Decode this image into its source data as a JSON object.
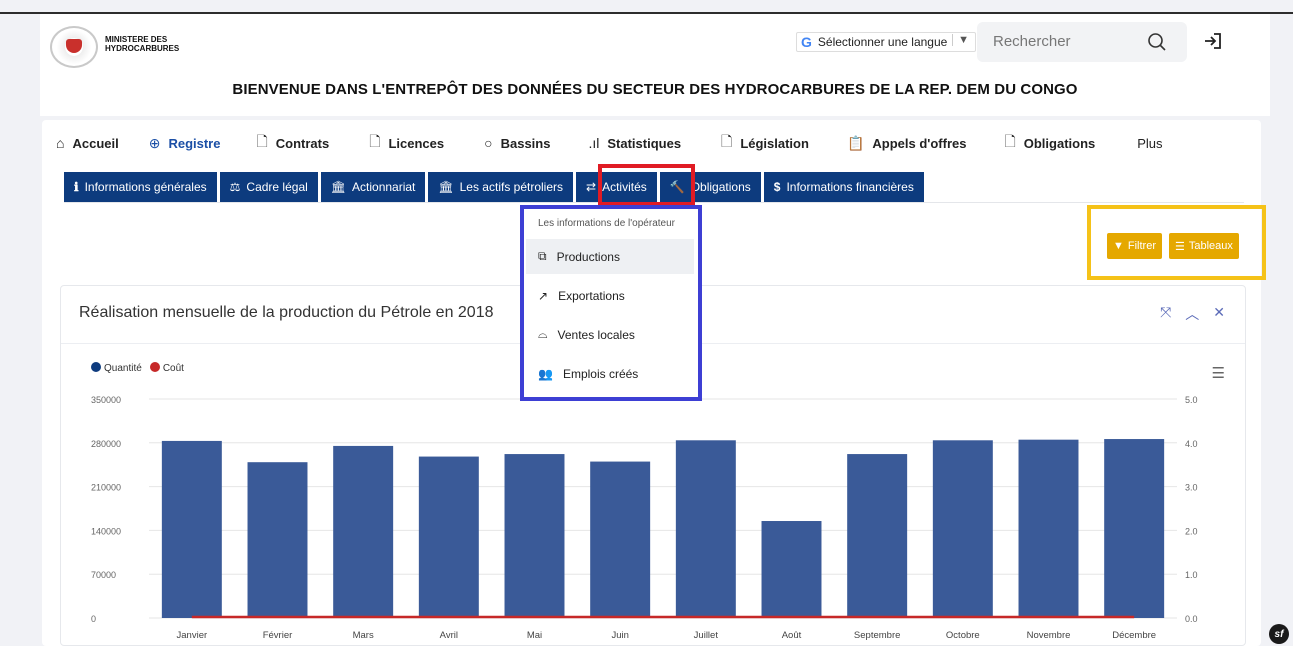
{
  "header": {
    "logo_text_line1": "MINISTERE DES",
    "logo_text_line2": "HYDROCARBURES",
    "language_label": "Sélectionner une langue",
    "search_placeholder": "Rechercher",
    "welcome": "BIENVENUE DANS L'ENTREPÔT DES DONNÉES DU SECTEUR DES HYDROCARBURES DE LA REP. DEM DU CONGO"
  },
  "main_nav": [
    {
      "label": "Accueil",
      "icon": "home-icon"
    },
    {
      "label": "Registre",
      "icon": "globe-icon",
      "active": true
    },
    {
      "label": "Contrats",
      "icon": "file-icon"
    },
    {
      "label": "Licences",
      "icon": "file-icon"
    },
    {
      "label": "Bassins",
      "icon": "circle-icon"
    },
    {
      "label": "Statistiques",
      "icon": "bar-chart-icon"
    },
    {
      "label": "Législation",
      "icon": "file-icon"
    },
    {
      "label": "Appels d'offres",
      "icon": "clipboard-icon"
    },
    {
      "label": "Obligations",
      "icon": "file-icon"
    },
    {
      "label": "Plus",
      "icon": ""
    }
  ],
  "sub_nav": [
    {
      "label": "Informations générales",
      "icon": "info-icon"
    },
    {
      "label": "Cadre légal",
      "icon": "scale-icon"
    },
    {
      "label": "Actionnariat",
      "icon": "bank-icon"
    },
    {
      "label": "Les actifs pétroliers",
      "icon": "bank-icon"
    },
    {
      "label": "Activités",
      "icon": "exchange-icon",
      "active": true
    },
    {
      "label": "Obligations",
      "icon": "gavel-icon"
    },
    {
      "label": "Informations financières",
      "icon": "dollar-icon"
    }
  ],
  "dropdown": {
    "header": "Les informations de l'opérateur",
    "items": [
      {
        "label": "Productions",
        "icon": "cubes-icon"
      },
      {
        "label": "Exportations",
        "icon": "external-link-icon"
      },
      {
        "label": "Ventes locales",
        "icon": "basket-icon"
      },
      {
        "label": "Emplois créés",
        "icon": "users-icon"
      }
    ]
  },
  "buttons": {
    "filter": "Filtrer",
    "tables": "Tableaux"
  },
  "colors": {
    "nav_blue": "#0d3b7e",
    "accent_yellow": "#e5a800",
    "bar_blue": "#3a5a98",
    "line_red": "#c62828"
  },
  "chart_data": {
    "type": "bar",
    "title": "Réalisation mensuelle de la production du Pétrole en 2018",
    "categories": [
      "Janvier",
      "Février",
      "Mars",
      "Avril",
      "Mai",
      "Juin",
      "Juillet",
      "Août",
      "Septembre",
      "Octobre",
      "Novembre",
      "Décembre"
    ],
    "series": [
      {
        "name": "Quantité",
        "type": "bar",
        "axis": "left",
        "color": "#3a5a98",
        "values": [
          283000,
          249000,
          275000,
          258000,
          262000,
          250000,
          284000,
          155000,
          262000,
          284000,
          285000,
          286000
        ]
      },
      {
        "name": "Coût",
        "type": "line",
        "axis": "right",
        "color": "#c62828",
        "values": [
          0,
          0,
          0,
          0,
          0,
          0,
          0,
          0,
          0,
          0,
          0,
          0
        ]
      }
    ],
    "ylim": [
      0,
      350000
    ],
    "yticks": [
      "0",
      "70000",
      "140000",
      "210000",
      "280000",
      "350000"
    ],
    "y2lim": [
      0,
      5
    ],
    "y2ticks": [
      "0.0",
      "1.0",
      "2.0",
      "3.0",
      "4.0",
      "5.0"
    ],
    "legend_position": "top-left",
    "grid": true
  }
}
